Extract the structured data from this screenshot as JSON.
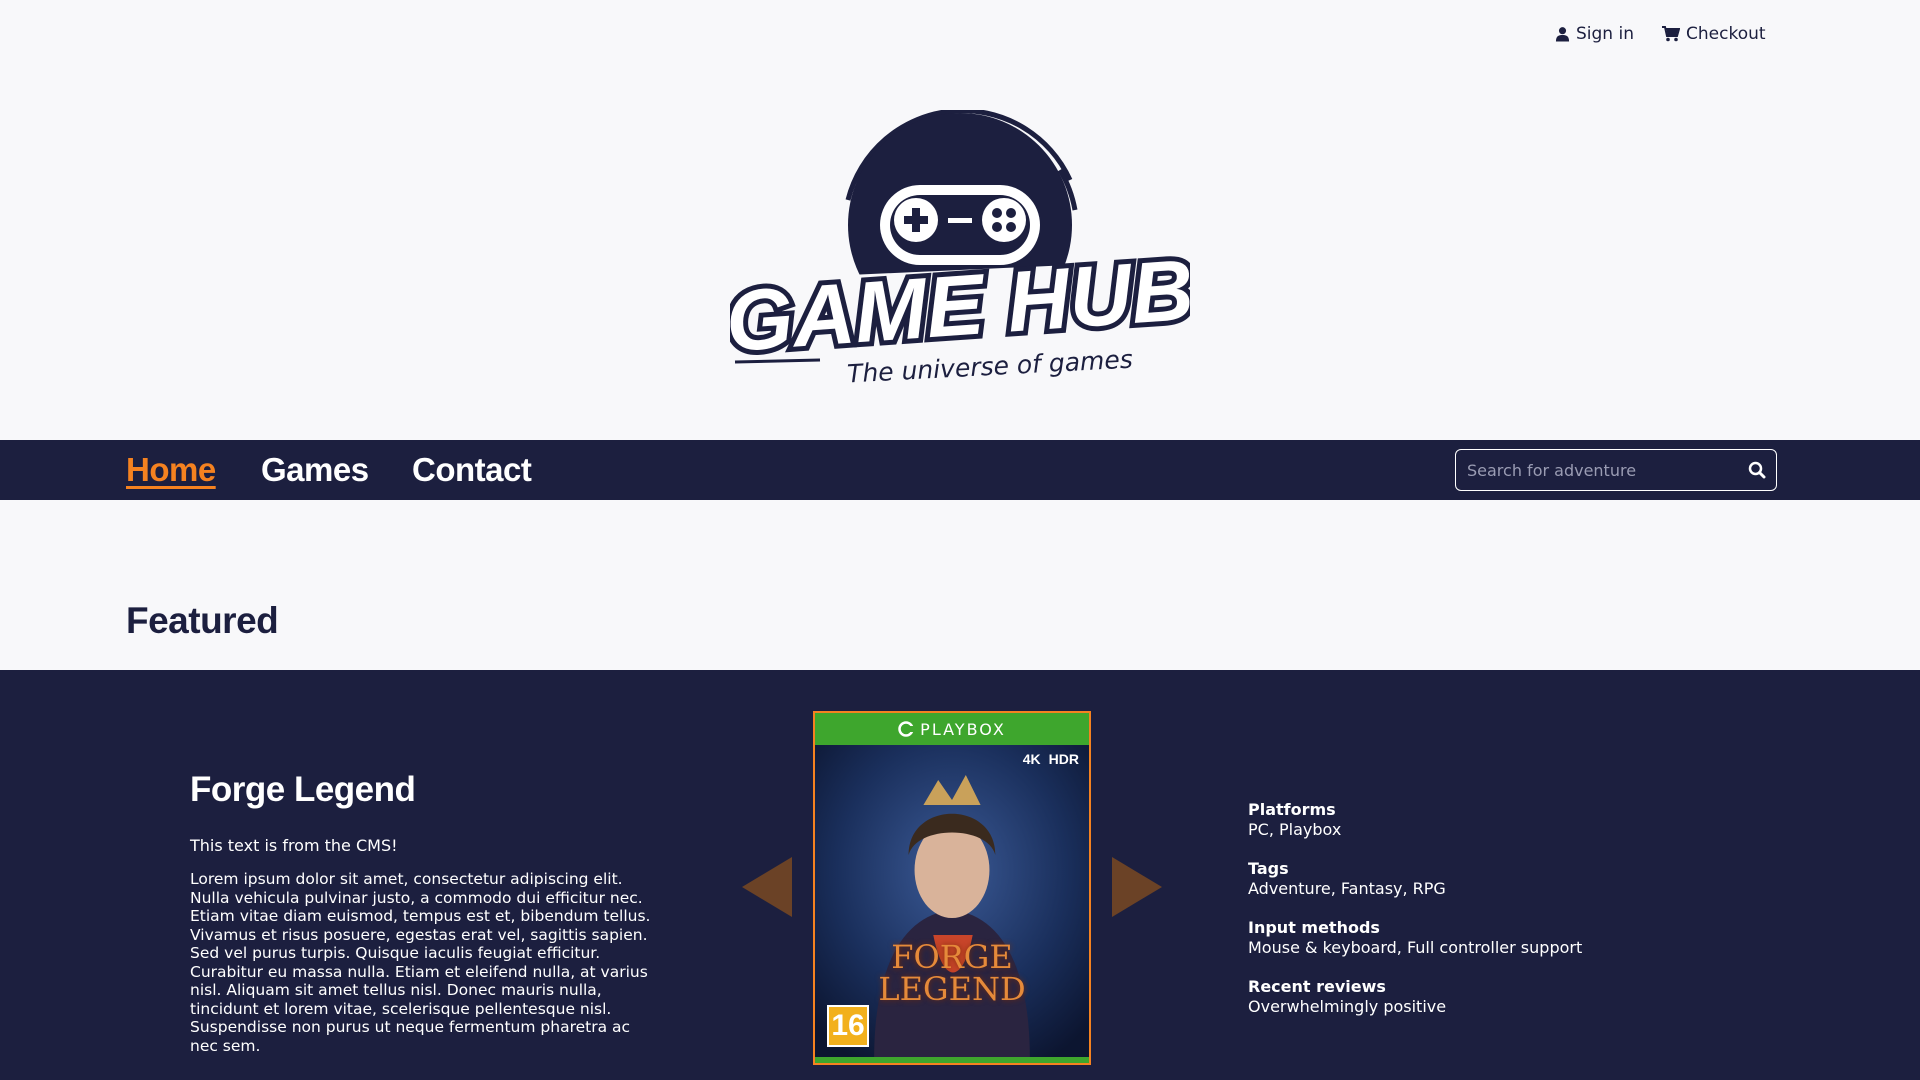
{
  "header": {
    "signin_label": "Sign in",
    "checkout_label": "Checkout"
  },
  "logo": {
    "name": "GAME HUB",
    "tagline": "The universe of games"
  },
  "nav": {
    "items": [
      {
        "label": "Home",
        "active": true
      },
      {
        "label": "Games",
        "active": false
      },
      {
        "label": "Contact",
        "active": false
      }
    ]
  },
  "search": {
    "placeholder": "Search for adventure",
    "icon": "search-icon"
  },
  "featured": {
    "heading": "Featured",
    "game": {
      "title": "Forge Legend",
      "cms_note": "This text is from the CMS!",
      "description": "Lorem ipsum dolor sit amet, consectetur adipiscing elit. Nulla vehicula pulvinar justo, a commodo dui efficitur nec. Etiam vitae diam euismod, tempus est et, bibendum tellus. Vivamus et risus posuere, egestas erat vel, sagittis sapien. Sed vel purus turpis. Quisque iaculis feugiat efficitur. Curabitur eu massa nulla. Etiam et eleifend nulla, at varius nisl. Aliquam sit amet tellus nisl. Donec mauris nulla, tincidunt et lorem vitae, scelerisque pellentesque nisl. Suspendisse non purus ut neque fermentum pharetra ac nec sem.",
      "cover": {
        "brand": "PLAYBOX",
        "badge_4k": "4K",
        "badge_hdr": "HDR",
        "title_line1": "FORGE",
        "title_line2": "LEGEND",
        "age_rating": "16"
      },
      "details": [
        {
          "label": "Platforms",
          "value": "PC, Playbox"
        },
        {
          "label": "Tags",
          "value": "Adventure, Fantasy, RPG"
        },
        {
          "label": "Input methods",
          "value": "Mouse & keyboard, Full controller support"
        },
        {
          "label": "Recent reviews",
          "value": "Overwhelmingly positive"
        }
      ]
    }
  },
  "colors": {
    "navy": "#1c1f3f",
    "accent": "#f58220",
    "arrow": "#6b4226",
    "cover_green": "#3ea62d"
  }
}
